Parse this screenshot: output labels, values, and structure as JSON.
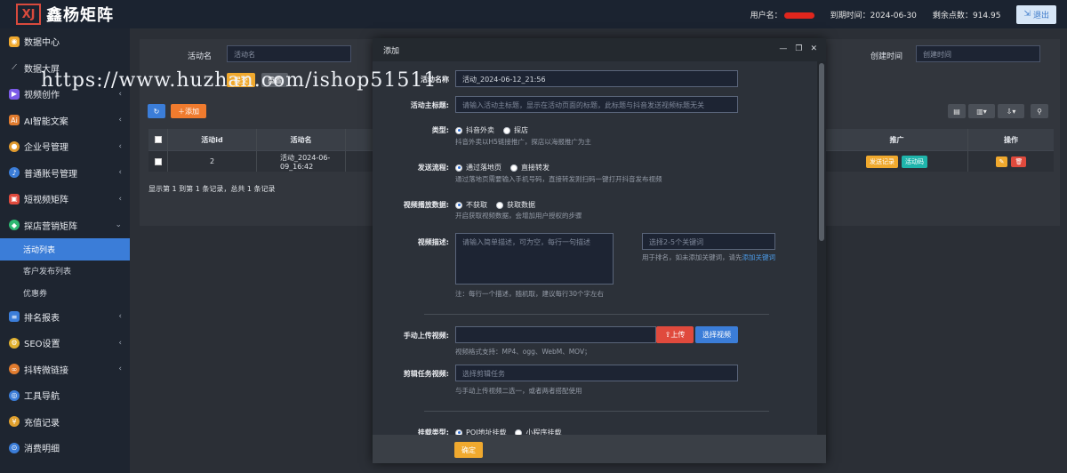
{
  "brand": {
    "logo_mark": "XJ",
    "name": "鑫杨矩阵"
  },
  "topbar": {
    "username_label": "用户名：",
    "expire_label": "到期时间：",
    "expire_value": "2024-06-30",
    "points_label": "剩余点数：",
    "points_value": "914.95",
    "logout_label": "退出"
  },
  "sidebar": {
    "items": [
      {
        "label": "数据中心",
        "icon": "data-center-icon",
        "color": "#f0a92e"
      },
      {
        "label": "数据大屏",
        "icon": "chart-icon",
        "color": "#4c9be8"
      },
      {
        "label": "视频创作",
        "icon": "video-icon",
        "color": "#7b5be8"
      },
      {
        "label": "AI智能文案",
        "icon": "ai-icon",
        "color": "#e07b2e"
      },
      {
        "label": "企业号管理",
        "icon": "enterprise-icon",
        "color": "#e09a2e"
      },
      {
        "label": "普通账号管理",
        "icon": "account-icon",
        "color": "#3b7dd8"
      },
      {
        "label": "短视频矩阵",
        "icon": "short-video-icon",
        "color": "#e04a3d"
      },
      {
        "label": "探店营销矩阵",
        "icon": "store-icon",
        "color": "#2eb872"
      },
      {
        "label": "排名报表",
        "icon": "rank-icon",
        "color": "#3b7dd8"
      },
      {
        "label": "SEO设置",
        "icon": "seo-icon",
        "color": "#e0b02e"
      },
      {
        "label": "抖转微链接",
        "icon": "link-icon",
        "color": "#e07b2e"
      },
      {
        "label": "工具导航",
        "icon": "tool-icon",
        "color": "#3b7dd8"
      },
      {
        "label": "充值记录",
        "icon": "recharge-icon",
        "color": "#e0a02e"
      },
      {
        "label": "消费明细",
        "icon": "consume-icon",
        "color": "#3b7dd8"
      }
    ],
    "sub_items": [
      "活动列表",
      "客户发布列表",
      "优惠券"
    ]
  },
  "main": {
    "filter_name_label": "活动名",
    "filter_name_placeholder": "活动名",
    "filter_created_label": "创建时间",
    "filter_created_placeholder": "创建时间",
    "search_label": "提交",
    "reset_label": "重置",
    "add_label": "添加",
    "table": {
      "columns": [
        "活动id",
        "活动名",
        "推广",
        "操作"
      ],
      "rows": [
        {
          "id": "2",
          "name": "活动_2024-06-09_16:42",
          "promo": [
            "发送记录",
            "活动码"
          ]
        }
      ]
    },
    "pagination_info": "显示第 1 到第 1 条记录，总共 1 条记录"
  },
  "modal": {
    "title": "添加",
    "fields": {
      "activity_name": {
        "label": "活动名称",
        "value": "活动_2024-06-12_21:56"
      },
      "main_title": {
        "label": "活动主标题:",
        "placeholder": "请输入活动主标题，显示在活动页面的标题，此标题与抖音发送视频标题无关"
      },
      "type": {
        "label": "类型:",
        "options": [
          "抖音外卖",
          "探店"
        ],
        "selected": 0,
        "hint": "抖音外卖以H5链接推广，探店以海报推广为主"
      },
      "send_flow": {
        "label": "发送流程:",
        "options": [
          "通过落地页",
          "直接转发"
        ],
        "selected": 0,
        "hint": "通过落地页需要输入手机号码，直接转发则扫码一键打开抖音发布视频"
      },
      "play_data": {
        "label": "视频播放数据:",
        "options": [
          "不获取",
          "获取数据"
        ],
        "selected": 0,
        "hint": "开启获取视频数据，会增加用户授权的步骤"
      },
      "description": {
        "label": "视频描述:",
        "placeholder": "请输入简单描述，可为空，每行一句描述",
        "keyword_placeholder": "选择2-5个关键词",
        "keyword_hint_1": "用于排名，如未添加关键词，请先",
        "keyword_hint_link": "添加关键词",
        "hint": "注：每行一个描述，随机取，建议每行30个字左右"
      },
      "manual_upload": {
        "label": "手动上传视频:",
        "upload_label": "上传",
        "choose_label": "选择视频",
        "hint": "视频格式支持：MP4、ogg、WebM、MOV；"
      },
      "edit_task": {
        "label": "剪辑任务视频:",
        "placeholder": "选择剪辑任务",
        "hint": "与手动上传视频二选一，或者两者搭配使用"
      },
      "mount_type": {
        "label": "挂载类型:",
        "options": [
          "POI地址挂载",
          "小程序挂载"
        ],
        "selected": 0
      }
    },
    "confirm_label": "确定"
  },
  "watermark": "https://www.huzhan.com/ishop51511"
}
